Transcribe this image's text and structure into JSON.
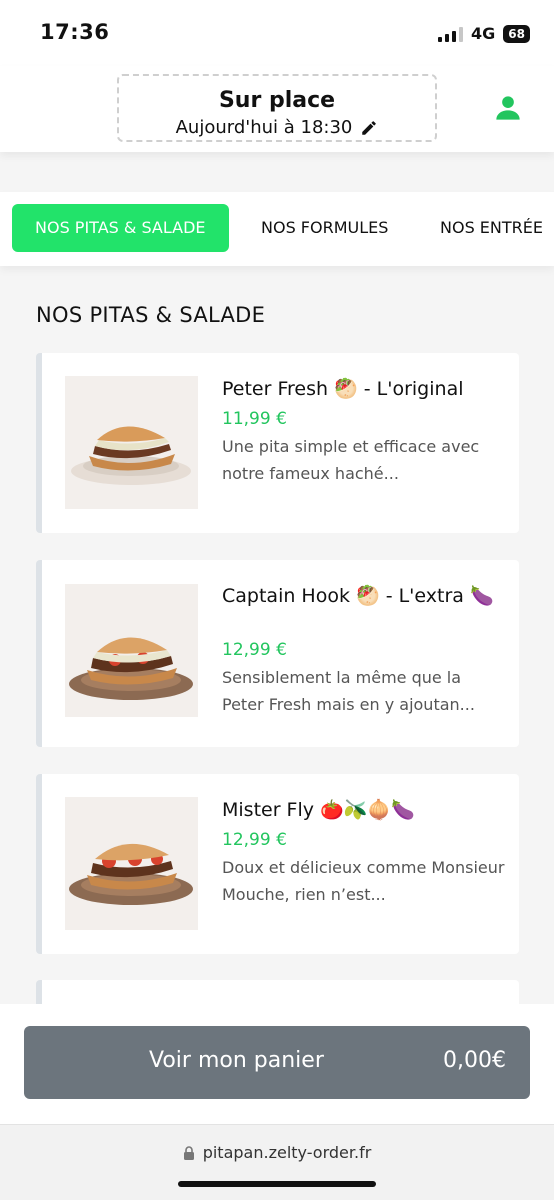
{
  "status_bar": {
    "time": "17:36",
    "network": "4G",
    "battery": "68"
  },
  "header": {
    "mode_title": "Sur place",
    "mode_time": "Aujourd'hui à 18:30",
    "edit_icon": "pencil-icon",
    "account_icon": "user-icon",
    "accent_color": "#22c55e"
  },
  "tabs": [
    {
      "label": "NOS PITAS & SALADE",
      "active": true
    },
    {
      "label": "NOS FORMULES",
      "active": false
    },
    {
      "label": "NOS ENTRÉE",
      "active": false
    }
  ],
  "section": {
    "title": "NOS PITAS & SALADE"
  },
  "products": [
    {
      "title": "Peter Fresh 🥙 - L'original",
      "price": "11,99 €",
      "description": "Une pita simple et efficace avec notre fameux haché..."
    },
    {
      "title": "Captain Hook 🥙 - L'extra 🍆",
      "price": "12,99 €",
      "description": "Sensiblement la même que la Peter Fresh mais en y ajoutan..."
    },
    {
      "title": "Mister Fly 🍅🫒🧅🍆",
      "price": "12,99 €",
      "description": "Doux et délicieux comme Monsieur Mouche, rien n’est..."
    }
  ],
  "cart": {
    "label": "Voir mon panier",
    "total": "0,00€"
  },
  "browser": {
    "url": "pitapan.zelty-order.fr"
  }
}
